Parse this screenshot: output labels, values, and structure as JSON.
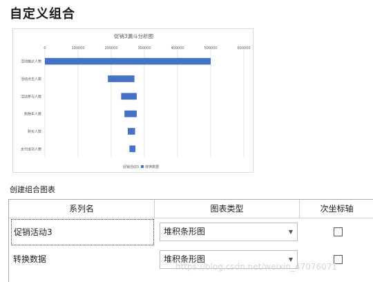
{
  "page": {
    "title": "自定义组合"
  },
  "chart_data": {
    "type": "bar",
    "orientation": "horizontal",
    "stacked": true,
    "title": "促销3漏斗分析图",
    "categories": [
      "活动触达人数",
      "活动点击人数",
      "活动参与人数",
      "购物车人数",
      "购买人数",
      "支付成功人数"
    ],
    "xticks": [
      "0",
      "100000",
      "200000",
      "300000",
      "400000",
      "500000",
      "600000"
    ],
    "xlim": [
      0,
      600000
    ],
    "series": [
      {
        "name": "促销活动3",
        "values": [
          0,
          190000,
          230000,
          240000,
          250000,
          255000
        ]
      },
      {
        "name": "转换数据",
        "values": [
          500000,
          80000,
          47000,
          37000,
          22000,
          18000
        ]
      }
    ],
    "grid": true,
    "legend": "bottom",
    "colors": {
      "visible_series": "#4472c4",
      "gridline": "#d9d9d9",
      "axis_text": "#595959"
    }
  },
  "section": {
    "label": "创建组合图表"
  },
  "table": {
    "headers": [
      "系列名",
      "图表类型",
      "次坐标轴"
    ],
    "rows": [
      {
        "name": "促销活动3",
        "chart_type": "堆积条形图",
        "secondary_axis": false
      },
      {
        "name": "转换数据",
        "chart_type": "堆积条形图",
        "secondary_axis": false
      }
    ]
  },
  "watermark": "https://blog.csdn.net/weixin_47076071"
}
